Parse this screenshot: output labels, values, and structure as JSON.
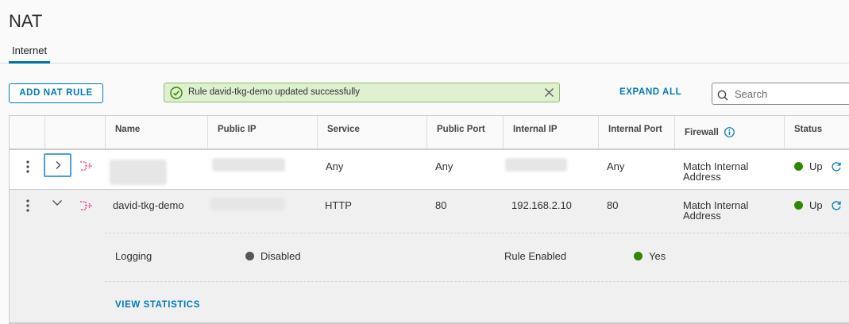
{
  "page": {
    "title": "NAT"
  },
  "tabs": [
    {
      "label": "Internet",
      "active": true
    }
  ],
  "toolbar": {
    "add_label": "ADD NAT RULE",
    "alert_text": "Rule david-tkg-demo updated successfully",
    "expand_all_label": "EXPAND ALL",
    "search_placeholder": "Search"
  },
  "table": {
    "columns": [
      "Name",
      "Public IP",
      "Service",
      "Public Port",
      "Internal IP",
      "Internal Port",
      "Firewall",
      "Status"
    ],
    "rows": [
      {
        "name": "",
        "public_ip": "",
        "service": "Any",
        "public_port": "Any",
        "internal_ip": "",
        "internal_port": "Any",
        "firewall": "Match Internal Address",
        "status": "Up",
        "expanded": false
      },
      {
        "name": "david-tkg-demo",
        "public_ip": "",
        "service": "HTTP",
        "public_port": "80",
        "internal_ip": "192.168.2.10",
        "internal_port": "80",
        "firewall": "Match Internal Address",
        "status": "Up",
        "expanded": true,
        "detail": {
          "logging_label": "Logging",
          "logging_value": "Disabled",
          "rule_enabled_label": "Rule Enabled",
          "rule_enabled_value": "Yes",
          "view_stats_label": "VIEW STATISTICS"
        }
      }
    ]
  },
  "colors": {
    "accent": "#0079b8",
    "status_up": "#318700",
    "status_disabled": "#565656",
    "success_bg": "#dff0d0",
    "success_border": "#8fbc6a"
  },
  "icons": {
    "success": "check-circle-icon",
    "close": "close-icon",
    "search": "search-icon",
    "info": "info-circle-icon",
    "kebab": "kebab-icon",
    "expand": "chevron-right-icon",
    "collapse": "chevron-down-icon",
    "rule": "nat-rule-icon",
    "refresh": "refresh-icon"
  }
}
